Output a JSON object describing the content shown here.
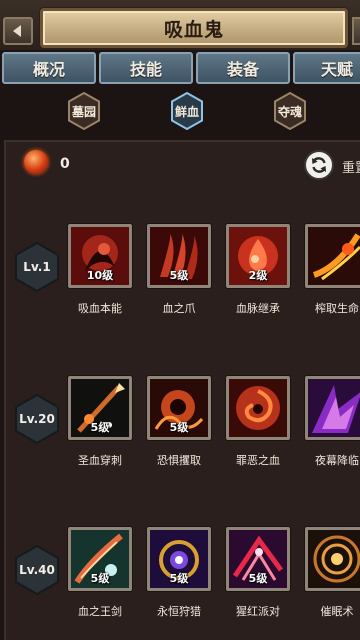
{
  "header": {
    "title": "吸血鬼"
  },
  "tabs": [
    {
      "label": "概况"
    },
    {
      "label": "技能"
    },
    {
      "label": "装备"
    },
    {
      "label": "天赋"
    }
  ],
  "subtabs": [
    {
      "label": "墓园",
      "active": false
    },
    {
      "label": "鲜血",
      "active": true
    },
    {
      "label": "夺魂",
      "active": false
    }
  ],
  "points": {
    "value": "0"
  },
  "reset": {
    "label": "重置"
  },
  "rows": [
    {
      "level": "Lv.1",
      "skills": [
        {
          "name": "吸血本能",
          "level": "10级"
        },
        {
          "name": "血之爪",
          "level": "5级"
        },
        {
          "name": "血脉继承",
          "level": "2级"
        },
        {
          "name": "榨取生命",
          "level": ""
        }
      ]
    },
    {
      "level": "Lv.20",
      "skills": [
        {
          "name": "圣血穿刺",
          "level": "5级"
        },
        {
          "name": "恐惧攫取",
          "level": "5级"
        },
        {
          "name": "罪恶之血",
          "level": ""
        },
        {
          "name": "夜幕降临",
          "level": ""
        }
      ]
    },
    {
      "level": "Lv.40",
      "skills": [
        {
          "name": "血之王剑",
          "level": "5级"
        },
        {
          "name": "永恒狩猎",
          "level": "5级"
        },
        {
          "name": "猩红派对",
          "level": "5级"
        },
        {
          "name": "催眠术",
          "level": ""
        }
      ]
    }
  ],
  "colors": {
    "background": "#1b1412",
    "panel": "#2a1f1c",
    "title_plate": "#c5ad82",
    "tab": "#4e6575",
    "level_hex": "#2b3238"
  }
}
